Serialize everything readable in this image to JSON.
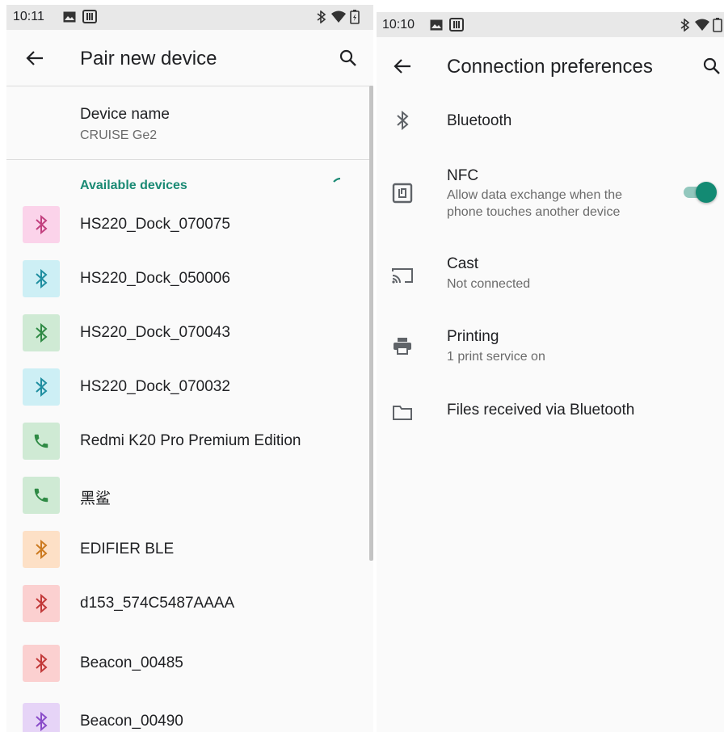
{
  "left": {
    "status": {
      "time": "10:11"
    },
    "toolbar": {
      "title": "Pair new device"
    },
    "device_name": {
      "label": "Device name",
      "value": "CRUISE Ge2"
    },
    "available_label": "Available devices",
    "devices": [
      {
        "name": "HS220_Dock_070075",
        "icon": "bluetooth-icon",
        "bg": "#fbd3ea",
        "fg": "#c2407f"
      },
      {
        "name": "HS220_Dock_050006",
        "icon": "bluetooth-icon",
        "bg": "#cdeff5",
        "fg": "#1f8ea0"
      },
      {
        "name": "HS220_Dock_070043",
        "icon": "bluetooth-icon",
        "bg": "#cfead4",
        "fg": "#2f8a45"
      },
      {
        "name": "HS220_Dock_070032",
        "icon": "bluetooth-icon",
        "bg": "#cdeff5",
        "fg": "#1f8ea0"
      },
      {
        "name": "Redmi K20 Pro Premium Edition",
        "icon": "phone-icon",
        "bg": "#cfead4",
        "fg": "#2f8a45"
      },
      {
        "name": "黑鲨",
        "icon": "phone-icon",
        "bg": "#cfead4",
        "fg": "#2f8a45"
      },
      {
        "name": "EDIFIER BLE",
        "icon": "bluetooth-icon",
        "bg": "#fde0c6",
        "fg": "#cc7a20"
      },
      {
        "name": "d153_574C5487AAAA",
        "icon": "bluetooth-icon",
        "bg": "#fbd0d0",
        "fg": "#c23a3a"
      },
      {
        "name": "Beacon_00485",
        "icon": "bluetooth-icon",
        "bg": "#fbd0d0",
        "fg": "#c23a3a"
      },
      {
        "name": "Beacon_00490",
        "icon": "bluetooth-icon",
        "bg": "#e6d4f7",
        "fg": "#8a4cc9"
      }
    ]
  },
  "right": {
    "status": {
      "time": "10:10"
    },
    "toolbar": {
      "title": "Connection preferences"
    },
    "items": [
      {
        "title": "Bluetooth",
        "subtitle": "",
        "icon": "bluetooth-icon"
      },
      {
        "title": "NFC",
        "subtitle": "Allow data exchange when the\nphone touches another device",
        "icon": "nfc-icon",
        "toggle_on": true
      },
      {
        "title": "Cast",
        "subtitle": "Not connected",
        "icon": "cast-icon"
      },
      {
        "title": "Printing",
        "subtitle": "1 print service on",
        "icon": "printer-icon"
      },
      {
        "title": "Files received via Bluetooth",
        "subtitle": "",
        "icon": "folder-icon"
      }
    ]
  },
  "colors": {
    "accent": "#1a8a74",
    "toggle_thumb": "#138a73",
    "toggle_track": "#138a73"
  }
}
